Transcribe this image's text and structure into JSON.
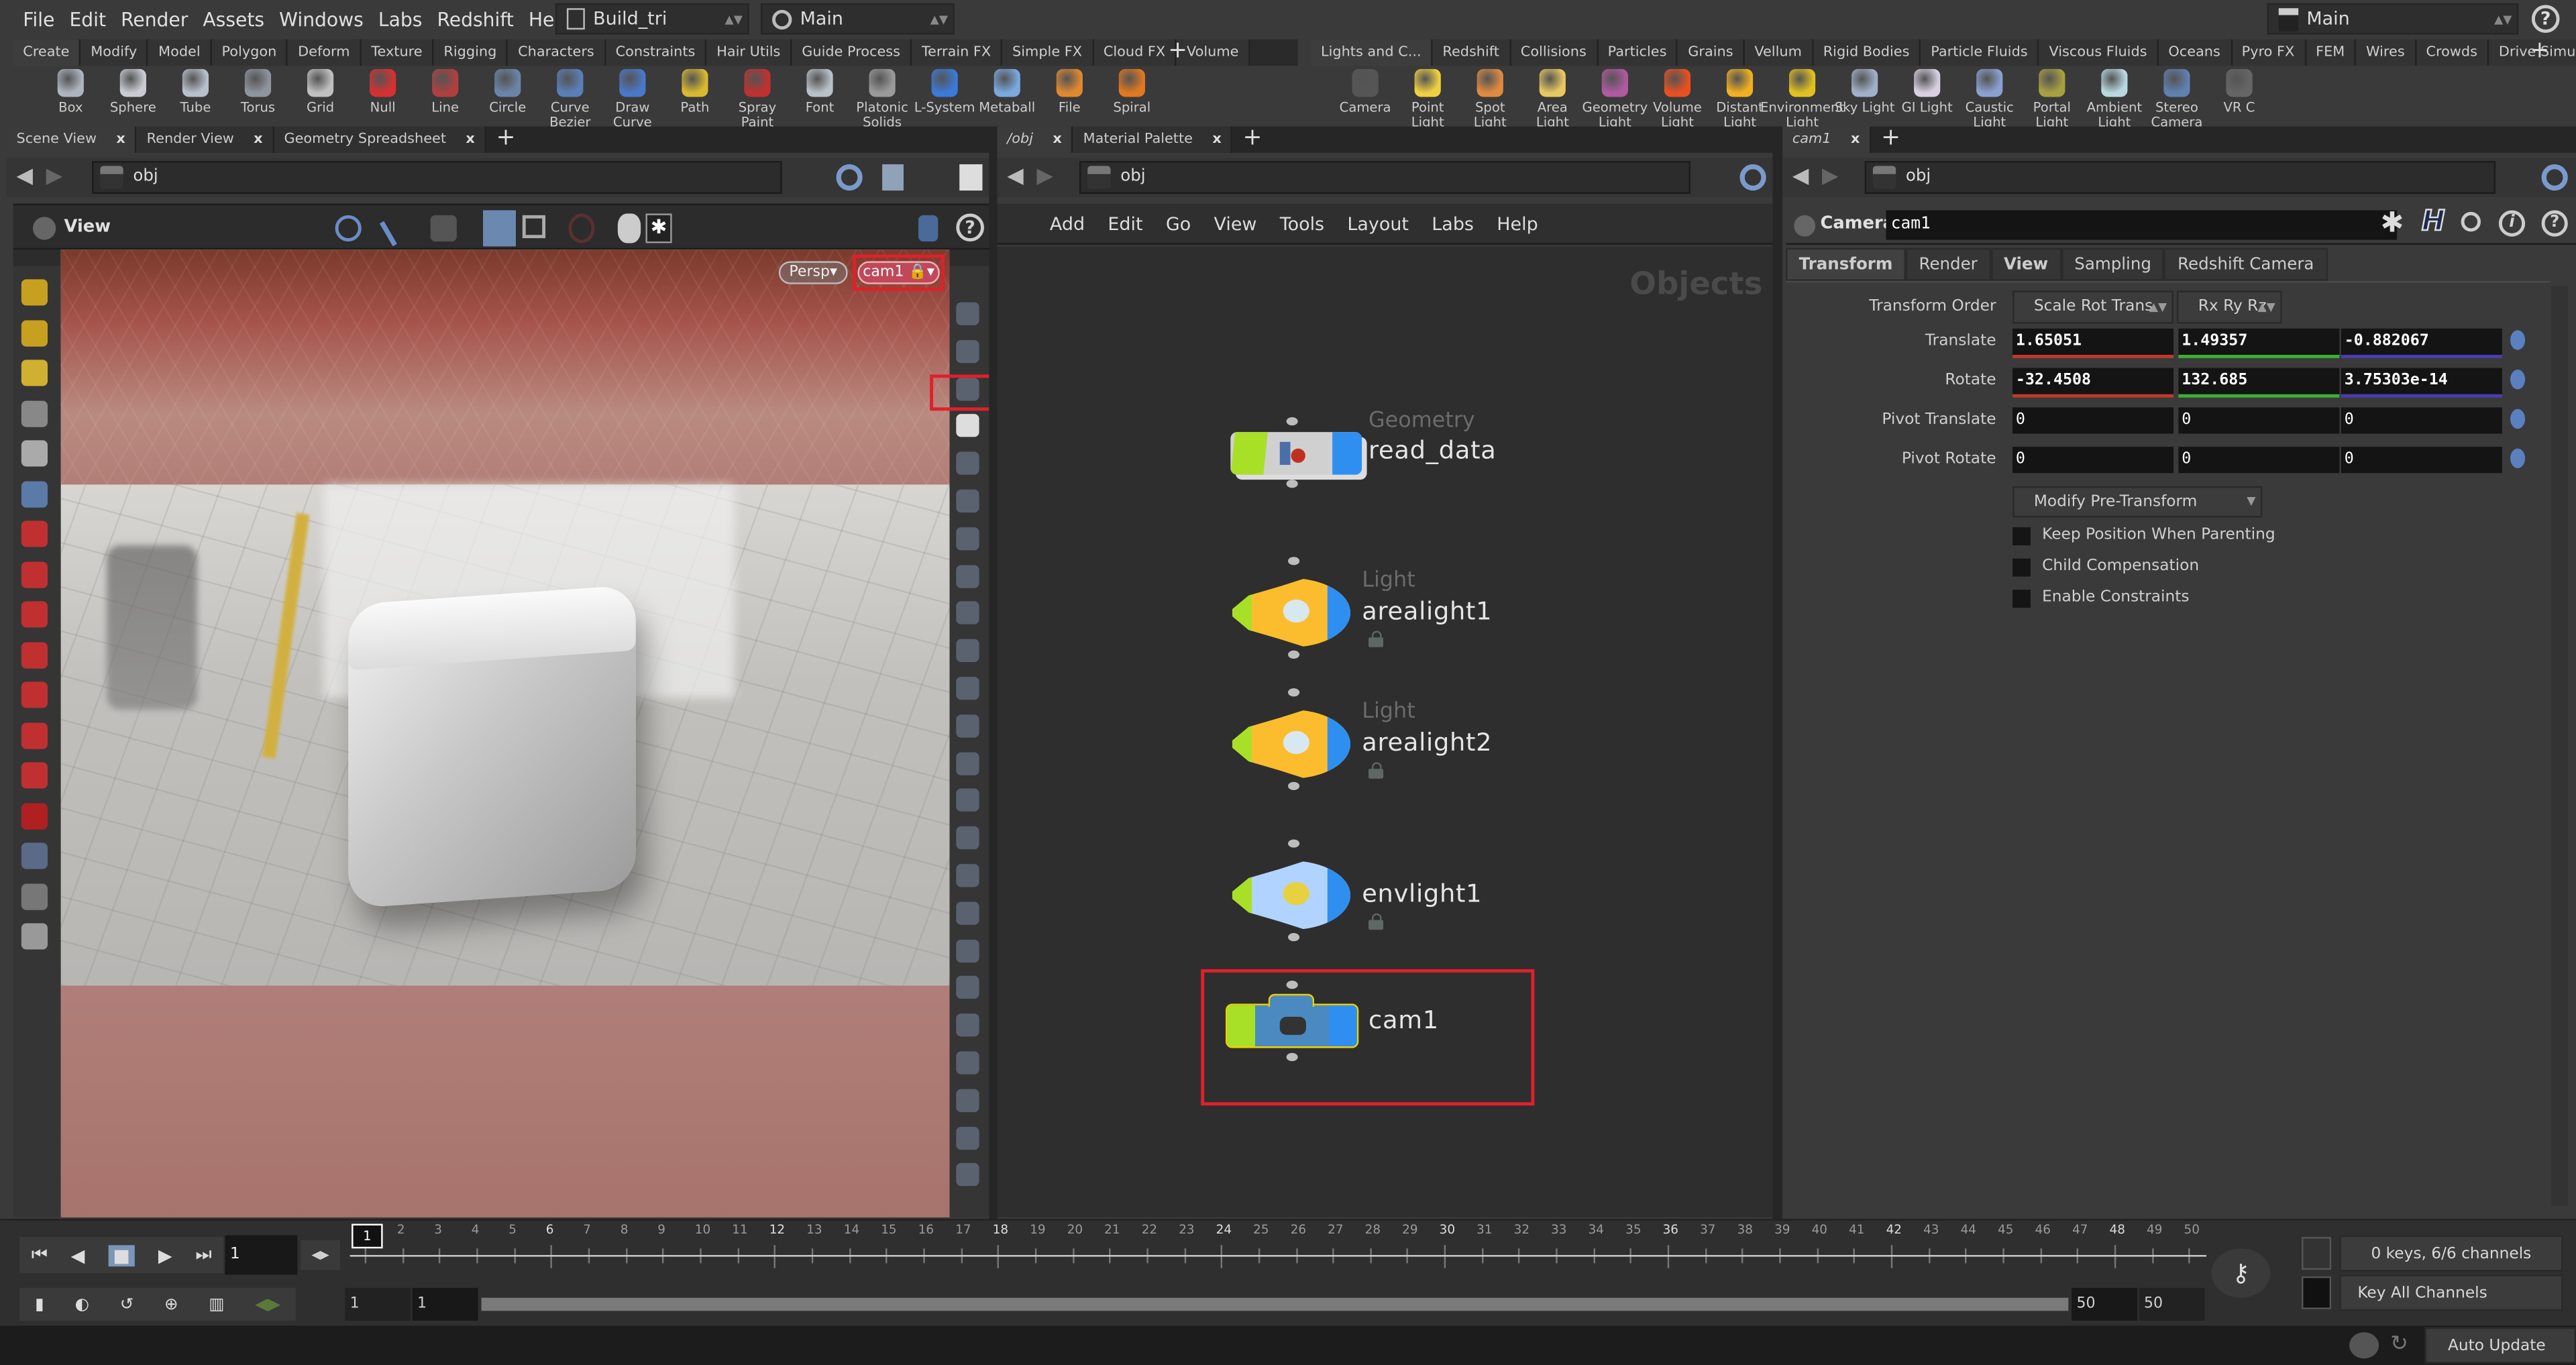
{
  "menu": [
    "File",
    "Edit",
    "Render",
    "Assets",
    "Windows",
    "Labs",
    "Redshift",
    "Help"
  ],
  "desktop": "Build_tri",
  "context": "Main",
  "takes": "Main",
  "shelf_left": {
    "tabs": [
      "Create",
      "Modify",
      "Model",
      "Polygon",
      "Deform",
      "Texture",
      "Rigging",
      "Characters",
      "Constraints",
      "Hair Utils",
      "Guide Process",
      "Terrain FX",
      "Simple FX",
      "Cloud FX",
      "Volume"
    ],
    "tools": [
      {
        "label": "Box",
        "color": "#aeb4be"
      },
      {
        "label": "Sphere",
        "color": "#c8ccd2"
      },
      {
        "label": "Tube",
        "color": "#b8c0cc"
      },
      {
        "label": "Torus",
        "color": "#8e959e"
      },
      {
        "label": "Grid",
        "color": "#c0c0c0"
      },
      {
        "label": "Null",
        "color": "#d83030"
      },
      {
        "label": "Line",
        "color": "#b04040"
      },
      {
        "label": "Circle",
        "color": "#6b85a8"
      },
      {
        "label": "Curve Bezier",
        "color": "#5a7fb8"
      },
      {
        "label": "Draw Curve",
        "color": "#4a78c8"
      },
      {
        "label": "Path",
        "color": "#d8b830"
      },
      {
        "label": "Spray Paint",
        "color": "#c03030"
      },
      {
        "label": "Font",
        "color": "#b8c0c8"
      },
      {
        "label": "Platonic Solids",
        "color": "#9a9a9a"
      },
      {
        "label": "L-System",
        "color": "#3a7ad8"
      },
      {
        "label": "Metaball",
        "color": "#7aa8e0"
      },
      {
        "label": "File",
        "color": "#e08830"
      },
      {
        "label": "Spiral",
        "color": "#e07820"
      }
    ]
  },
  "shelf_right": {
    "tabs": [
      "Lights and C...",
      "Redshift",
      "Collisions",
      "Particles",
      "Grains",
      "Vellum",
      "Rigid Bodies",
      "Particle Fluids",
      "Viscous Fluids",
      "Oceans",
      "Pyro FX",
      "FEM",
      "Wires",
      "Crowds",
      "Drive Simula..."
    ],
    "tools": [
      {
        "label": "Camera",
        "color": "#555"
      },
      {
        "label": "Point Light",
        "color": "#f0d040"
      },
      {
        "label": "Spot Light",
        "color": "#e08a40"
      },
      {
        "label": "Area Light",
        "color": "#e8c860"
      },
      {
        "label": "Geometry Light",
        "color": "#b05aa0"
      },
      {
        "label": "Volume Light",
        "color": "#e85020"
      },
      {
        "label": "Distant Light",
        "color": "#f0b020"
      },
      {
        "label": "Environment Light",
        "color": "#e0c020"
      },
      {
        "label": "Sky Light",
        "color": "#a0b0c8"
      },
      {
        "label": "GI Light",
        "color": "#d8d0e0"
      },
      {
        "label": "Caustic Light",
        "color": "#8aa0d0"
      },
      {
        "label": "Portal Light",
        "color": "#a8a040"
      },
      {
        "label": "Ambient Light",
        "color": "#b8d8e0"
      },
      {
        "label": "Stereo Camera",
        "color": "#6080b0"
      },
      {
        "label": "VR C",
        "color": "#666"
      }
    ]
  },
  "scene_pane": {
    "tabs": [
      "Scene View",
      "Render View",
      "Geometry Spreadsheet"
    ],
    "path": "obj",
    "view_label": "View",
    "persp_label": "Persp",
    "camera_label": "cam1"
  },
  "network_pane": {
    "tabs": [
      "/obj",
      "Material Palette"
    ],
    "path": "obj",
    "menu": [
      "Add",
      "Edit",
      "Go",
      "View",
      "Tools",
      "Layout",
      "Labs",
      "Help"
    ],
    "context_label": "Objects",
    "nodes": [
      {
        "type": "Geometry",
        "name": "read_data"
      },
      {
        "type": "Light",
        "name": "arealight1"
      },
      {
        "type": "Light",
        "name": "arealight2"
      },
      {
        "type": "",
        "name": "envlight1"
      },
      {
        "type": "",
        "name": "cam1"
      }
    ]
  },
  "params_pane": {
    "tab": "cam1",
    "path": "obj",
    "node_type": "Camera",
    "node_name": "cam1",
    "tabs": [
      "Transform",
      "Render",
      "View",
      "Sampling",
      "Redshift Camera"
    ],
    "transform_order_label": "Transform Order",
    "transform_order": "Scale Rot Trans",
    "rotate_order": "Rx Ry Rz",
    "rows": [
      {
        "label": "Translate",
        "values": [
          "1.65051",
          "1.49357",
          "-0.882067"
        ]
      },
      {
        "label": "Rotate",
        "values": [
          "-32.4508",
          "132.685",
          "3.75303e-14"
        ]
      },
      {
        "label": "Pivot Translate",
        "values": [
          "0",
          "0",
          "0"
        ]
      },
      {
        "label": "Pivot Rotate",
        "values": [
          "0",
          "0",
          "0"
        ]
      }
    ],
    "pre_transform": "Modify Pre-Transform",
    "checkboxes": [
      {
        "label": "Keep Position When Parenting",
        "checked": false
      },
      {
        "label": "Child Compensation",
        "checked": false
      },
      {
        "label": "Enable Constraints",
        "checked": false
      }
    ],
    "axis_colors": [
      "#c0392b",
      "#3cb034",
      "#4a3cb0"
    ]
  },
  "timeline": {
    "current_frame": "1",
    "ticks": [
      "1",
      "2",
      "3",
      "4",
      "5",
      "6",
      "7",
      "8",
      "9",
      "10",
      "11",
      "12",
      "13",
      "14",
      "15",
      "16",
      "17",
      "18",
      "19",
      "20",
      "21",
      "22",
      "23",
      "24",
      "25",
      "26",
      "27",
      "28",
      "29",
      "30",
      "31",
      "32",
      "33",
      "34",
      "35",
      "36",
      "37",
      "38",
      "39",
      "40",
      "41",
      "42",
      "43",
      "44",
      "45",
      "46",
      "47",
      "48",
      "49",
      "50"
    ],
    "range_start": "1",
    "playback_start": "1",
    "playback_end": "50",
    "range_end": "50",
    "keys_status": "0 keys, 6/6 channels",
    "key_mode": "Key All Channels"
  },
  "status": {
    "update_mode": "Auto Update"
  },
  "highlight_color": "#e0202a"
}
